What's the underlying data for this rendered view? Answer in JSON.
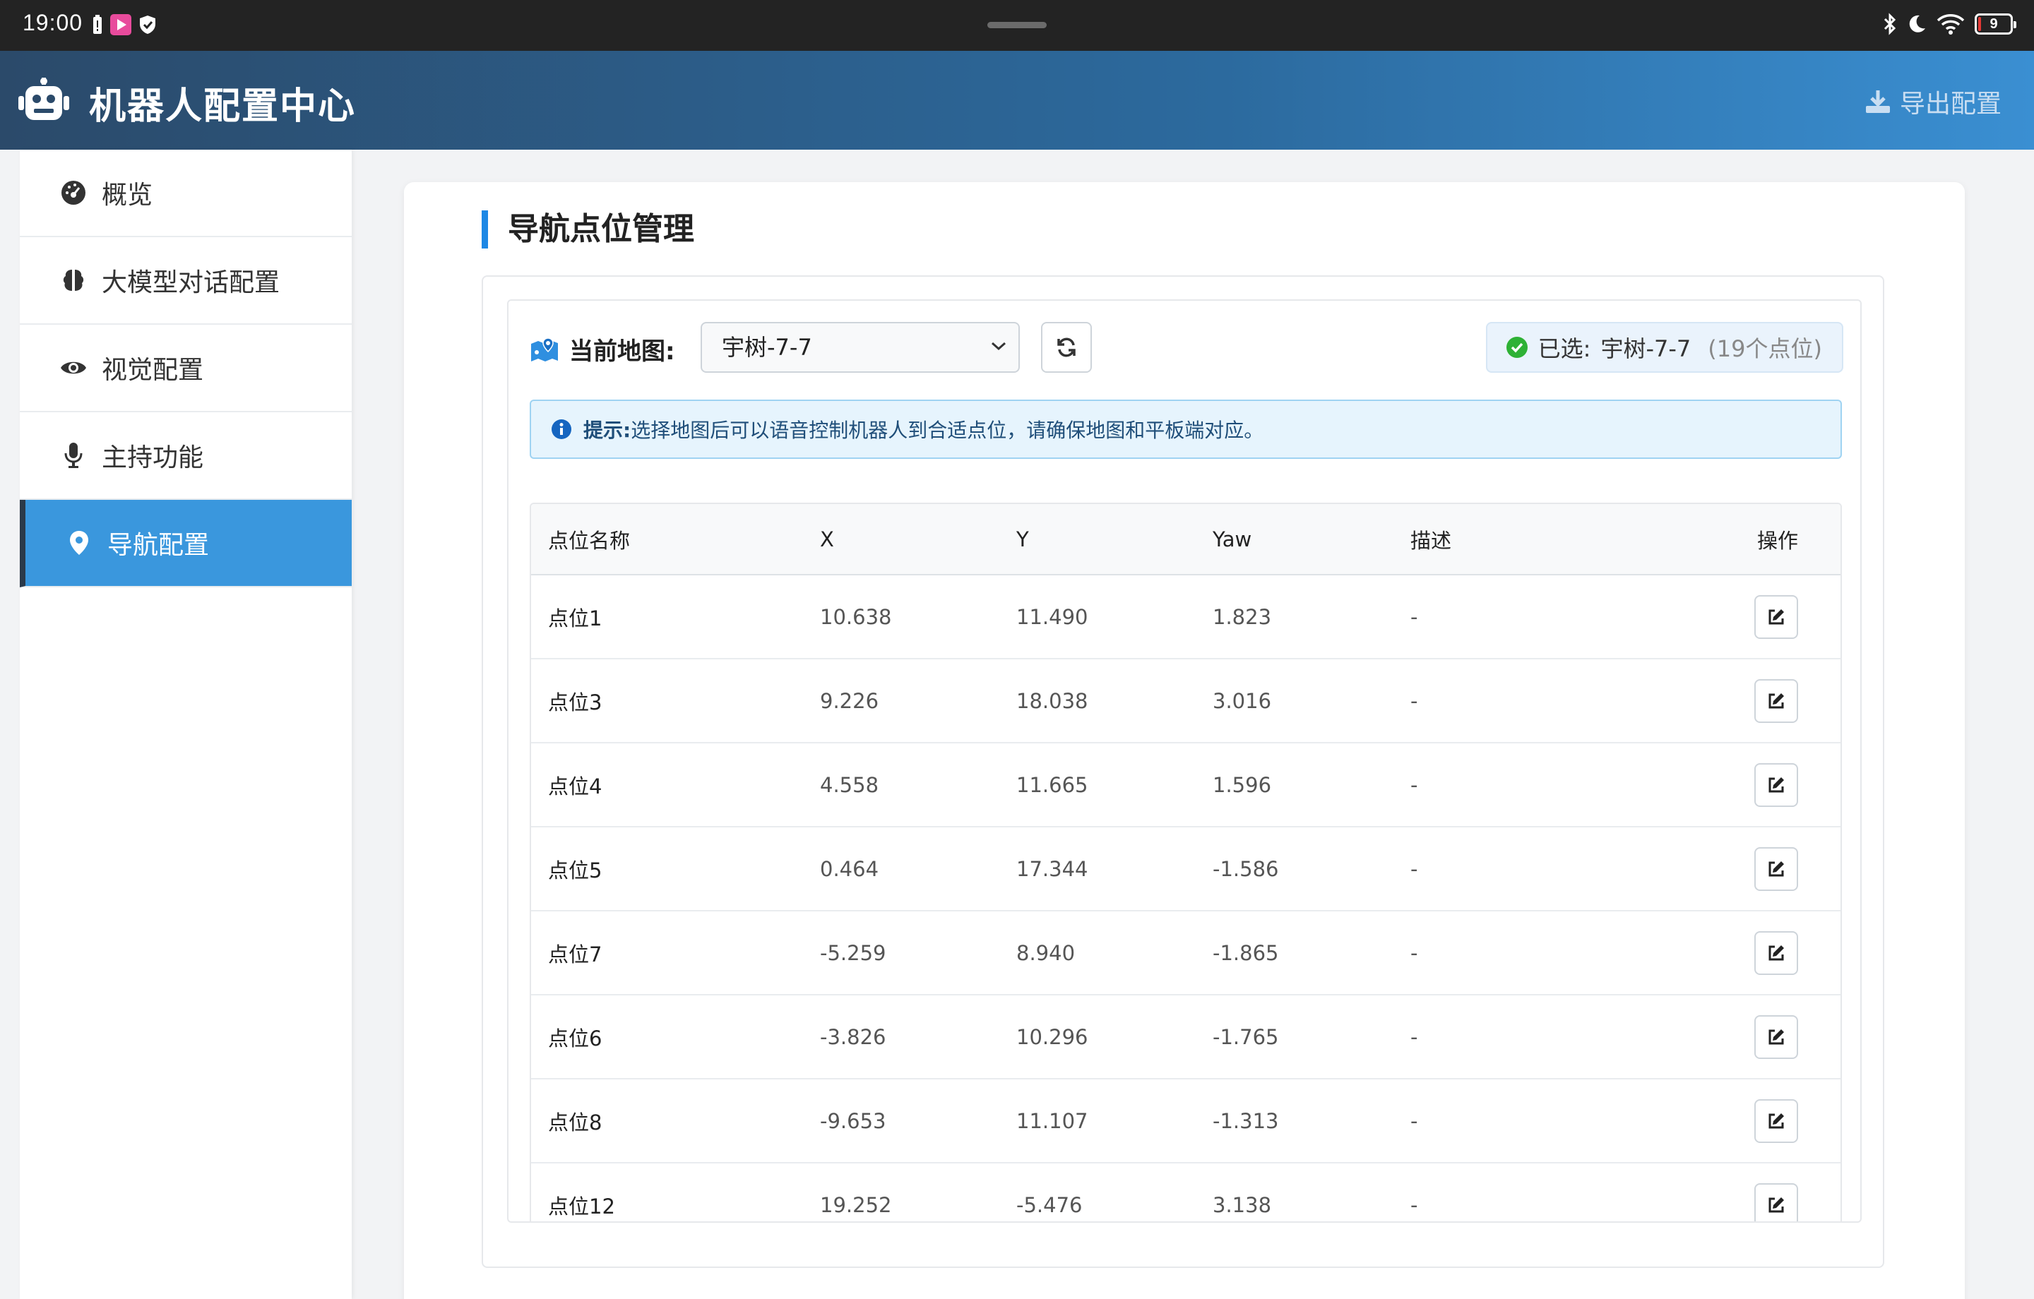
{
  "status_bar": {
    "time": "19:00",
    "battery": "9"
  },
  "header": {
    "title": "机器人配置中心",
    "export_label": "导出配置"
  },
  "sidebar": {
    "items": [
      {
        "label": "概览",
        "icon": "dashboard-icon"
      },
      {
        "label": "大模型对话配置",
        "icon": "brain-icon"
      },
      {
        "label": "视觉配置",
        "icon": "eye-icon"
      },
      {
        "label": "主持功能",
        "icon": "microphone-icon"
      },
      {
        "label": "导航配置",
        "icon": "map-pin-icon",
        "active": true
      }
    ]
  },
  "main": {
    "section_title": "导航点位管理",
    "map_label": "当前地图:",
    "map_select_value": "宇树-7-7",
    "selected_prefix": "已选:",
    "selected_map": "宇树-7-7",
    "selected_count": "(19个点位)",
    "tip_label": "提示:",
    "tip_text": "选择地图后可以语音控制机器人到合适点位，请确保地图和平板端对应。"
  },
  "table": {
    "headers": {
      "name": "点位名称",
      "x": "X",
      "y": "Y",
      "yaw": "Yaw",
      "desc": "描述",
      "op": "操作"
    },
    "rows": [
      {
        "name": "点位1",
        "x": "10.638",
        "y": "11.490",
        "yaw": "1.823",
        "desc": "-"
      },
      {
        "name": "点位3",
        "x": "9.226",
        "y": "18.038",
        "yaw": "3.016",
        "desc": "-"
      },
      {
        "name": "点位4",
        "x": "4.558",
        "y": "11.665",
        "yaw": "1.596",
        "desc": "-"
      },
      {
        "name": "点位5",
        "x": "0.464",
        "y": "17.344",
        "yaw": "-1.586",
        "desc": "-"
      },
      {
        "name": "点位7",
        "x": "-5.259",
        "y": "8.940",
        "yaw": "-1.865",
        "desc": "-"
      },
      {
        "name": "点位6",
        "x": "-3.826",
        "y": "10.296",
        "yaw": "-1.765",
        "desc": "-"
      },
      {
        "name": "点位8",
        "x": "-9.653",
        "y": "11.107",
        "yaw": "-1.313",
        "desc": "-"
      },
      {
        "name": "点位12",
        "x": "19.252",
        "y": "-5.476",
        "yaw": "3.138",
        "desc": "-"
      }
    ]
  },
  "colors": {
    "accent": "#3a97dd",
    "header_start": "#2b4a6a",
    "header_end": "#3a8fd2",
    "success": "#2eb135"
  }
}
